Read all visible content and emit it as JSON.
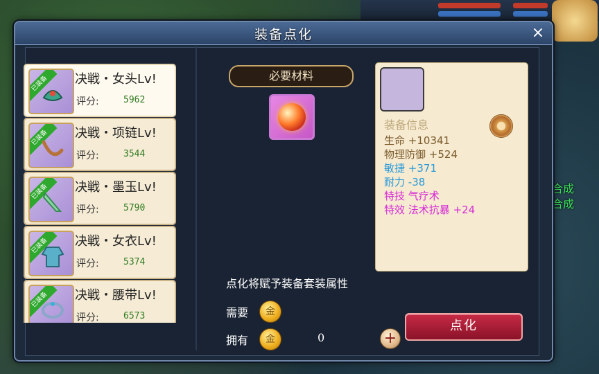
{
  "background": {
    "side_text": [
      "合成",
      "合成"
    ]
  },
  "dialog": {
    "title": "装备点化",
    "close_icon": "×"
  },
  "equipment_list": {
    "equipped_tag": "已装备",
    "score_label": "评分:",
    "items": [
      {
        "name": "决戦・女头Lv!",
        "score": "5962",
        "icon": "helmet-icon",
        "selected": true
      },
      {
        "name": "决戦・项链Lv!",
        "score": "3544",
        "icon": "necklace-icon",
        "selected": false
      },
      {
        "name": "决戦・墨玉Lv!",
        "score": "5790",
        "icon": "jade-icon",
        "selected": false
      },
      {
        "name": "决戦・女衣Lv!",
        "score": "5374",
        "icon": "robe-icon",
        "selected": false
      },
      {
        "name": "决戦・腰带Lv!",
        "score": "6573",
        "icon": "belt-icon",
        "selected": false
      }
    ]
  },
  "materials": {
    "banner": "必要材料",
    "item_icon": "fire-orb-icon"
  },
  "info": {
    "title": "装备信息",
    "stats": [
      {
        "label": "生命",
        "value": "+10341",
        "color": "#7a5a2a"
      },
      {
        "label": "物理防御",
        "value": "+524",
        "color": "#7a5a2a"
      },
      {
        "label": "敏捷",
        "value": "+371",
        "color": "#2a9ad8"
      },
      {
        "label": "耐力",
        "value": "-38",
        "color": "#2a9ad8"
      },
      {
        "label": "特技",
        "value": "气疗术",
        "color": "#d62ad6"
      },
      {
        "label": "特效",
        "value": "法术抗暴 +24",
        "color": "#d62ad6"
      }
    ]
  },
  "bottom": {
    "description": "点化将赋予装备套装属性",
    "need_label": "需要",
    "own_label": "拥有",
    "coin_symbol": "金",
    "own_value": "0",
    "plus_label": "+",
    "action_label": "点化"
  }
}
